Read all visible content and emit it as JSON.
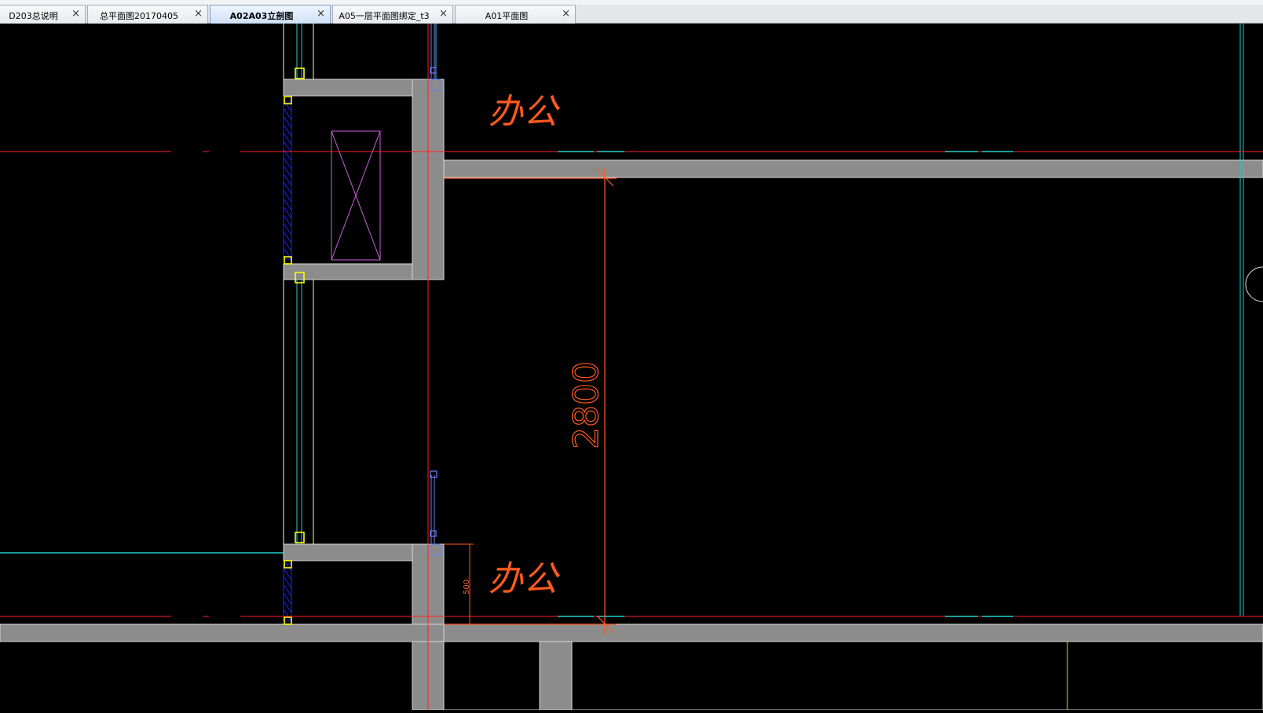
{
  "tabs": [
    {
      "label": "D203总说明",
      "close": "×",
      "active": false
    },
    {
      "label": "总平面图20170405",
      "close": "×",
      "active": false
    },
    {
      "label": "A02A03立剖图",
      "close": "×",
      "active": true
    },
    {
      "label": "A05一层平面图绑定_t3",
      "close": "×",
      "active": false
    },
    {
      "label": "A01平面图",
      "close": "×",
      "active": false
    }
  ],
  "drawing": {
    "room_label_top": "办公",
    "room_label_bottom": "办公",
    "dimension_large": "2800",
    "dimension_small": "500"
  },
  "colors": {
    "background": "#000000",
    "wall": "#8c8c8c",
    "axis_line": "#ff2020",
    "dimension": "#ff5a1e",
    "window": "#20d0d0",
    "column_marker": "#ffff00",
    "door_magenta": "#d060e0",
    "hatch_blue": "#2020ff"
  }
}
